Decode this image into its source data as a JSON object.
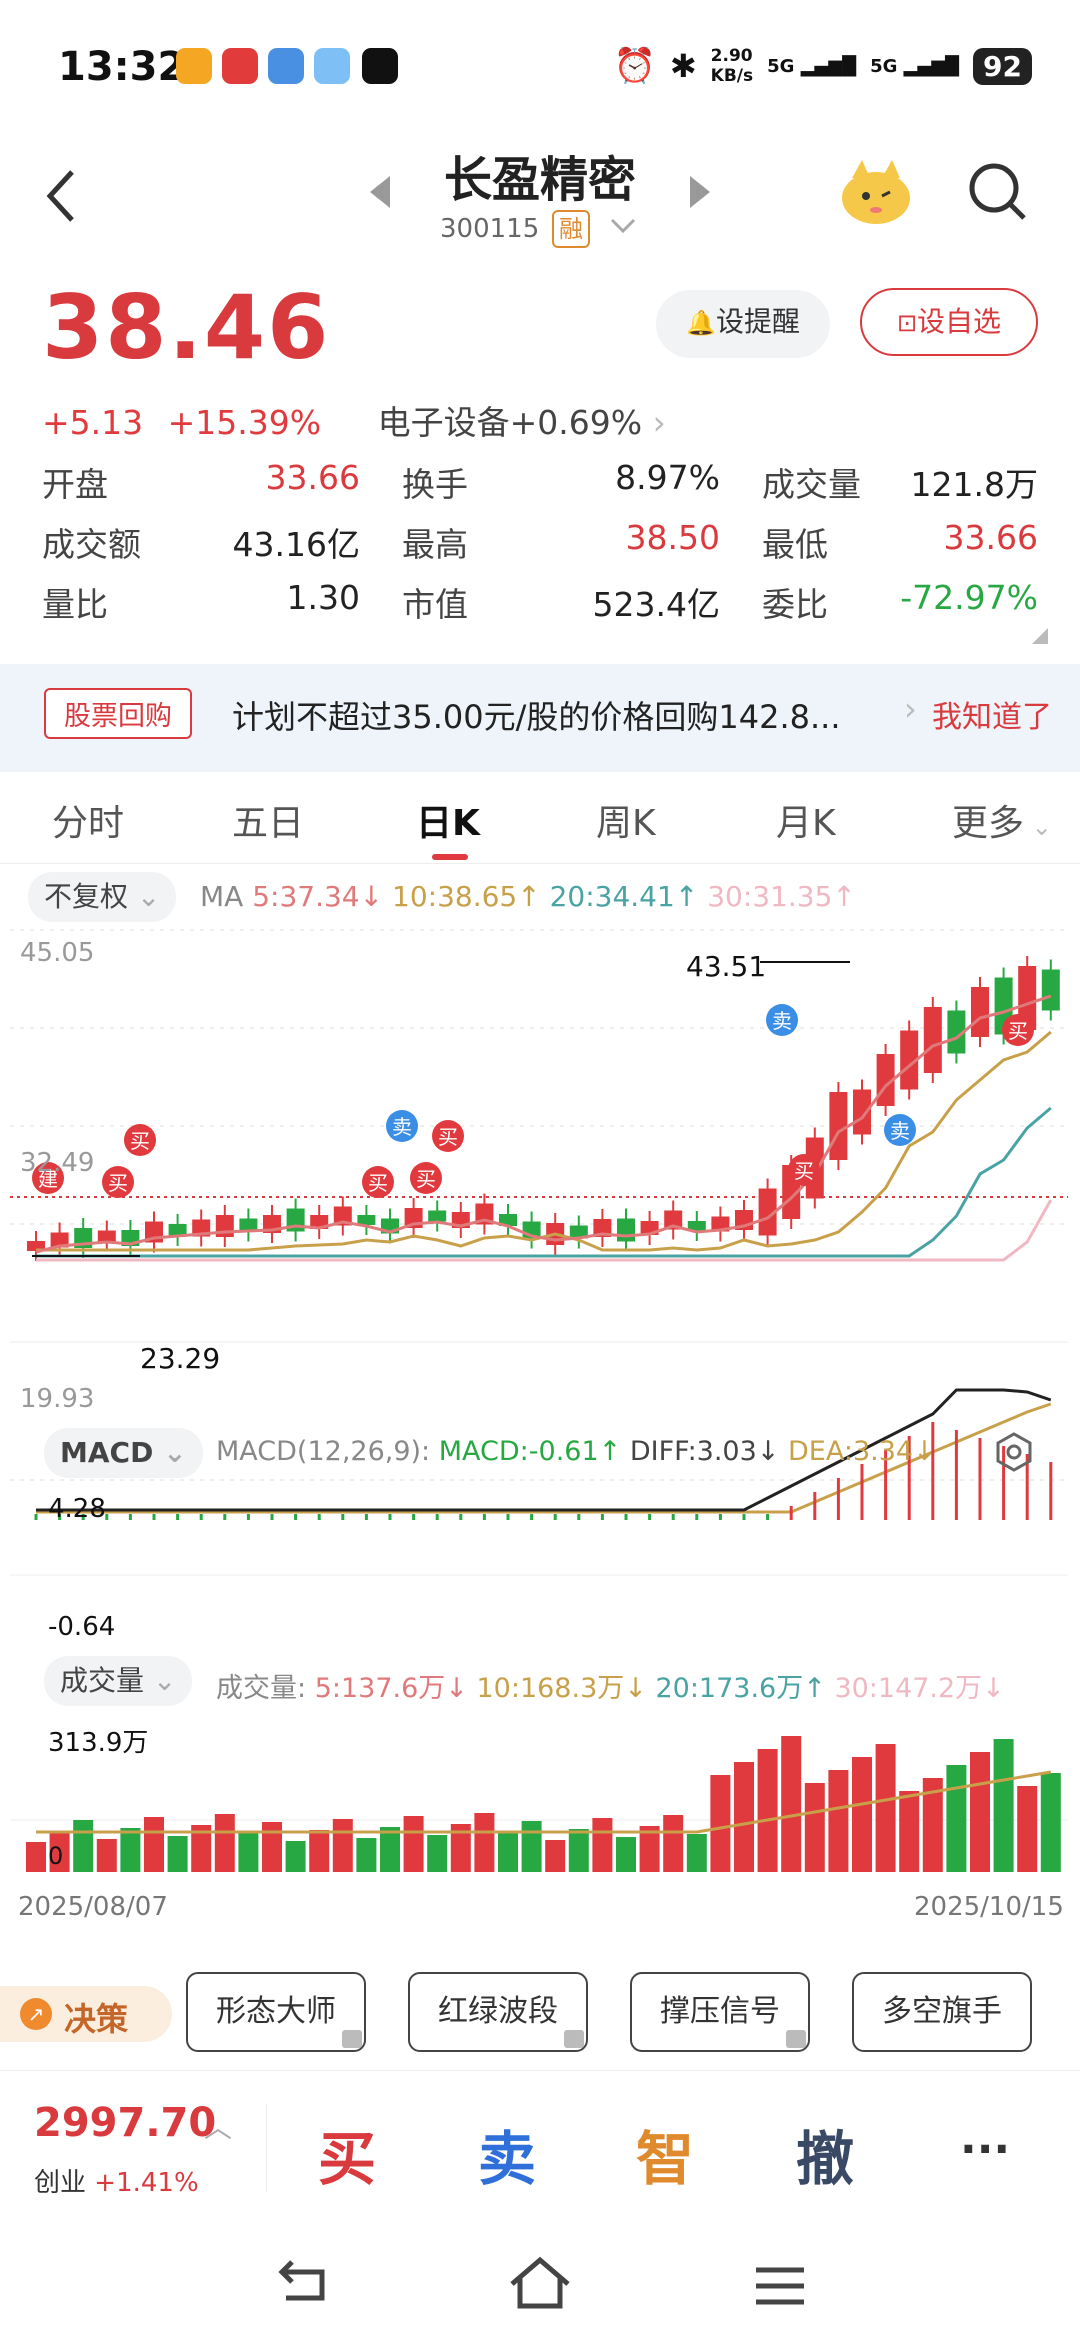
{
  "status_bar": {
    "time": "13:32",
    "net_speed": "2.90\nKB/s",
    "net_speed_top": "2.90",
    "net_speed_bottom": "KB/s",
    "sig1": "5G",
    "sig2": "5G",
    "battery": "92"
  },
  "nav": {
    "title": "长盈精密",
    "code": "300115",
    "badge": "融"
  },
  "quote": {
    "price": "38.46",
    "change": "+5.13",
    "change_pct": "+15.39%",
    "sector": "电子设备",
    "sector_pct": "+0.69%",
    "alert_btn": "设提醒",
    "watch_btn": "设自选",
    "rows": [
      [
        {
          "label": "开盘",
          "value": "33.66",
          "color": "red"
        },
        {
          "label": "换手",
          "value": "8.97%",
          "color": "dark"
        },
        {
          "label": "成交量",
          "value": "121.8万",
          "color": "dark"
        }
      ],
      [
        {
          "label": "成交额",
          "value": "43.16亿",
          "color": "dark"
        },
        {
          "label": "最高",
          "value": "38.50",
          "color": "red"
        },
        {
          "label": "最低",
          "value": "33.66",
          "color": "red"
        }
      ],
      [
        {
          "label": "量比",
          "value": "1.30",
          "color": "dark"
        },
        {
          "label": "市值",
          "value": "523.4亿",
          "color": "dark"
        },
        {
          "label": "委比",
          "value": "-72.97%",
          "color": "green"
        }
      ]
    ]
  },
  "notice": {
    "tag": "股票回购",
    "text": "计划不超过35.00元/股的价格回购142.8...",
    "action": "我知道了"
  },
  "tabs": [
    "分时",
    "五日",
    "日K",
    "周K",
    "月K",
    "更多"
  ],
  "chart_controls": {
    "adjust": "不复权",
    "ma_label": "MA",
    "ma5": "5:37.34↓",
    "ma10": "10:38.65↑",
    "ma20": "20:34.41↑",
    "ma30": "30:31.35↑"
  },
  "kline": {
    "top_label": "45.05",
    "mid_label": "32.49",
    "bottom_label": "19.93",
    "high_annot": "43.51",
    "low_annot": "23.29",
    "markers": {
      "build": "建",
      "buy": "买",
      "sell": "卖"
    }
  },
  "macd": {
    "selector": "MACD",
    "params": "MACD(12,26,9):",
    "macd": "MACD:-0.61↑",
    "diff": "DIFF:3.03↓",
    "dea": "DEA:3.34↓",
    "top_label": "4.28",
    "bottom_label": "-0.64"
  },
  "volume": {
    "selector": "成交量",
    "label": "成交量:",
    "v5": "5:137.6万↓",
    "v10": "10:168.3万↓",
    "v20": "20:173.6万↑",
    "v30": "30:147.2万↓",
    "top_label": "313.9万",
    "zero_label": "0",
    "start_date": "2025/08/07",
    "end_date": "2025/10/15"
  },
  "tools": {
    "decision": "决策",
    "items": [
      "形态大师",
      "红绿波段",
      "撑压信号",
      "多空旗手"
    ]
  },
  "bottom": {
    "index_value": "2997.70",
    "index_name": "创业",
    "index_pct": "+1.41%",
    "buy": "买",
    "sell": "卖",
    "smart": "智",
    "cancel": "撤",
    "more": "···"
  },
  "colors": {
    "up": "#e03a3e",
    "down": "#27a843",
    "ma5": "#e07a7a",
    "ma10": "#c9a04a",
    "ma20": "#4aa3a3",
    "ma30": "#f0b8c2",
    "accent": "#e03a3e"
  }
}
